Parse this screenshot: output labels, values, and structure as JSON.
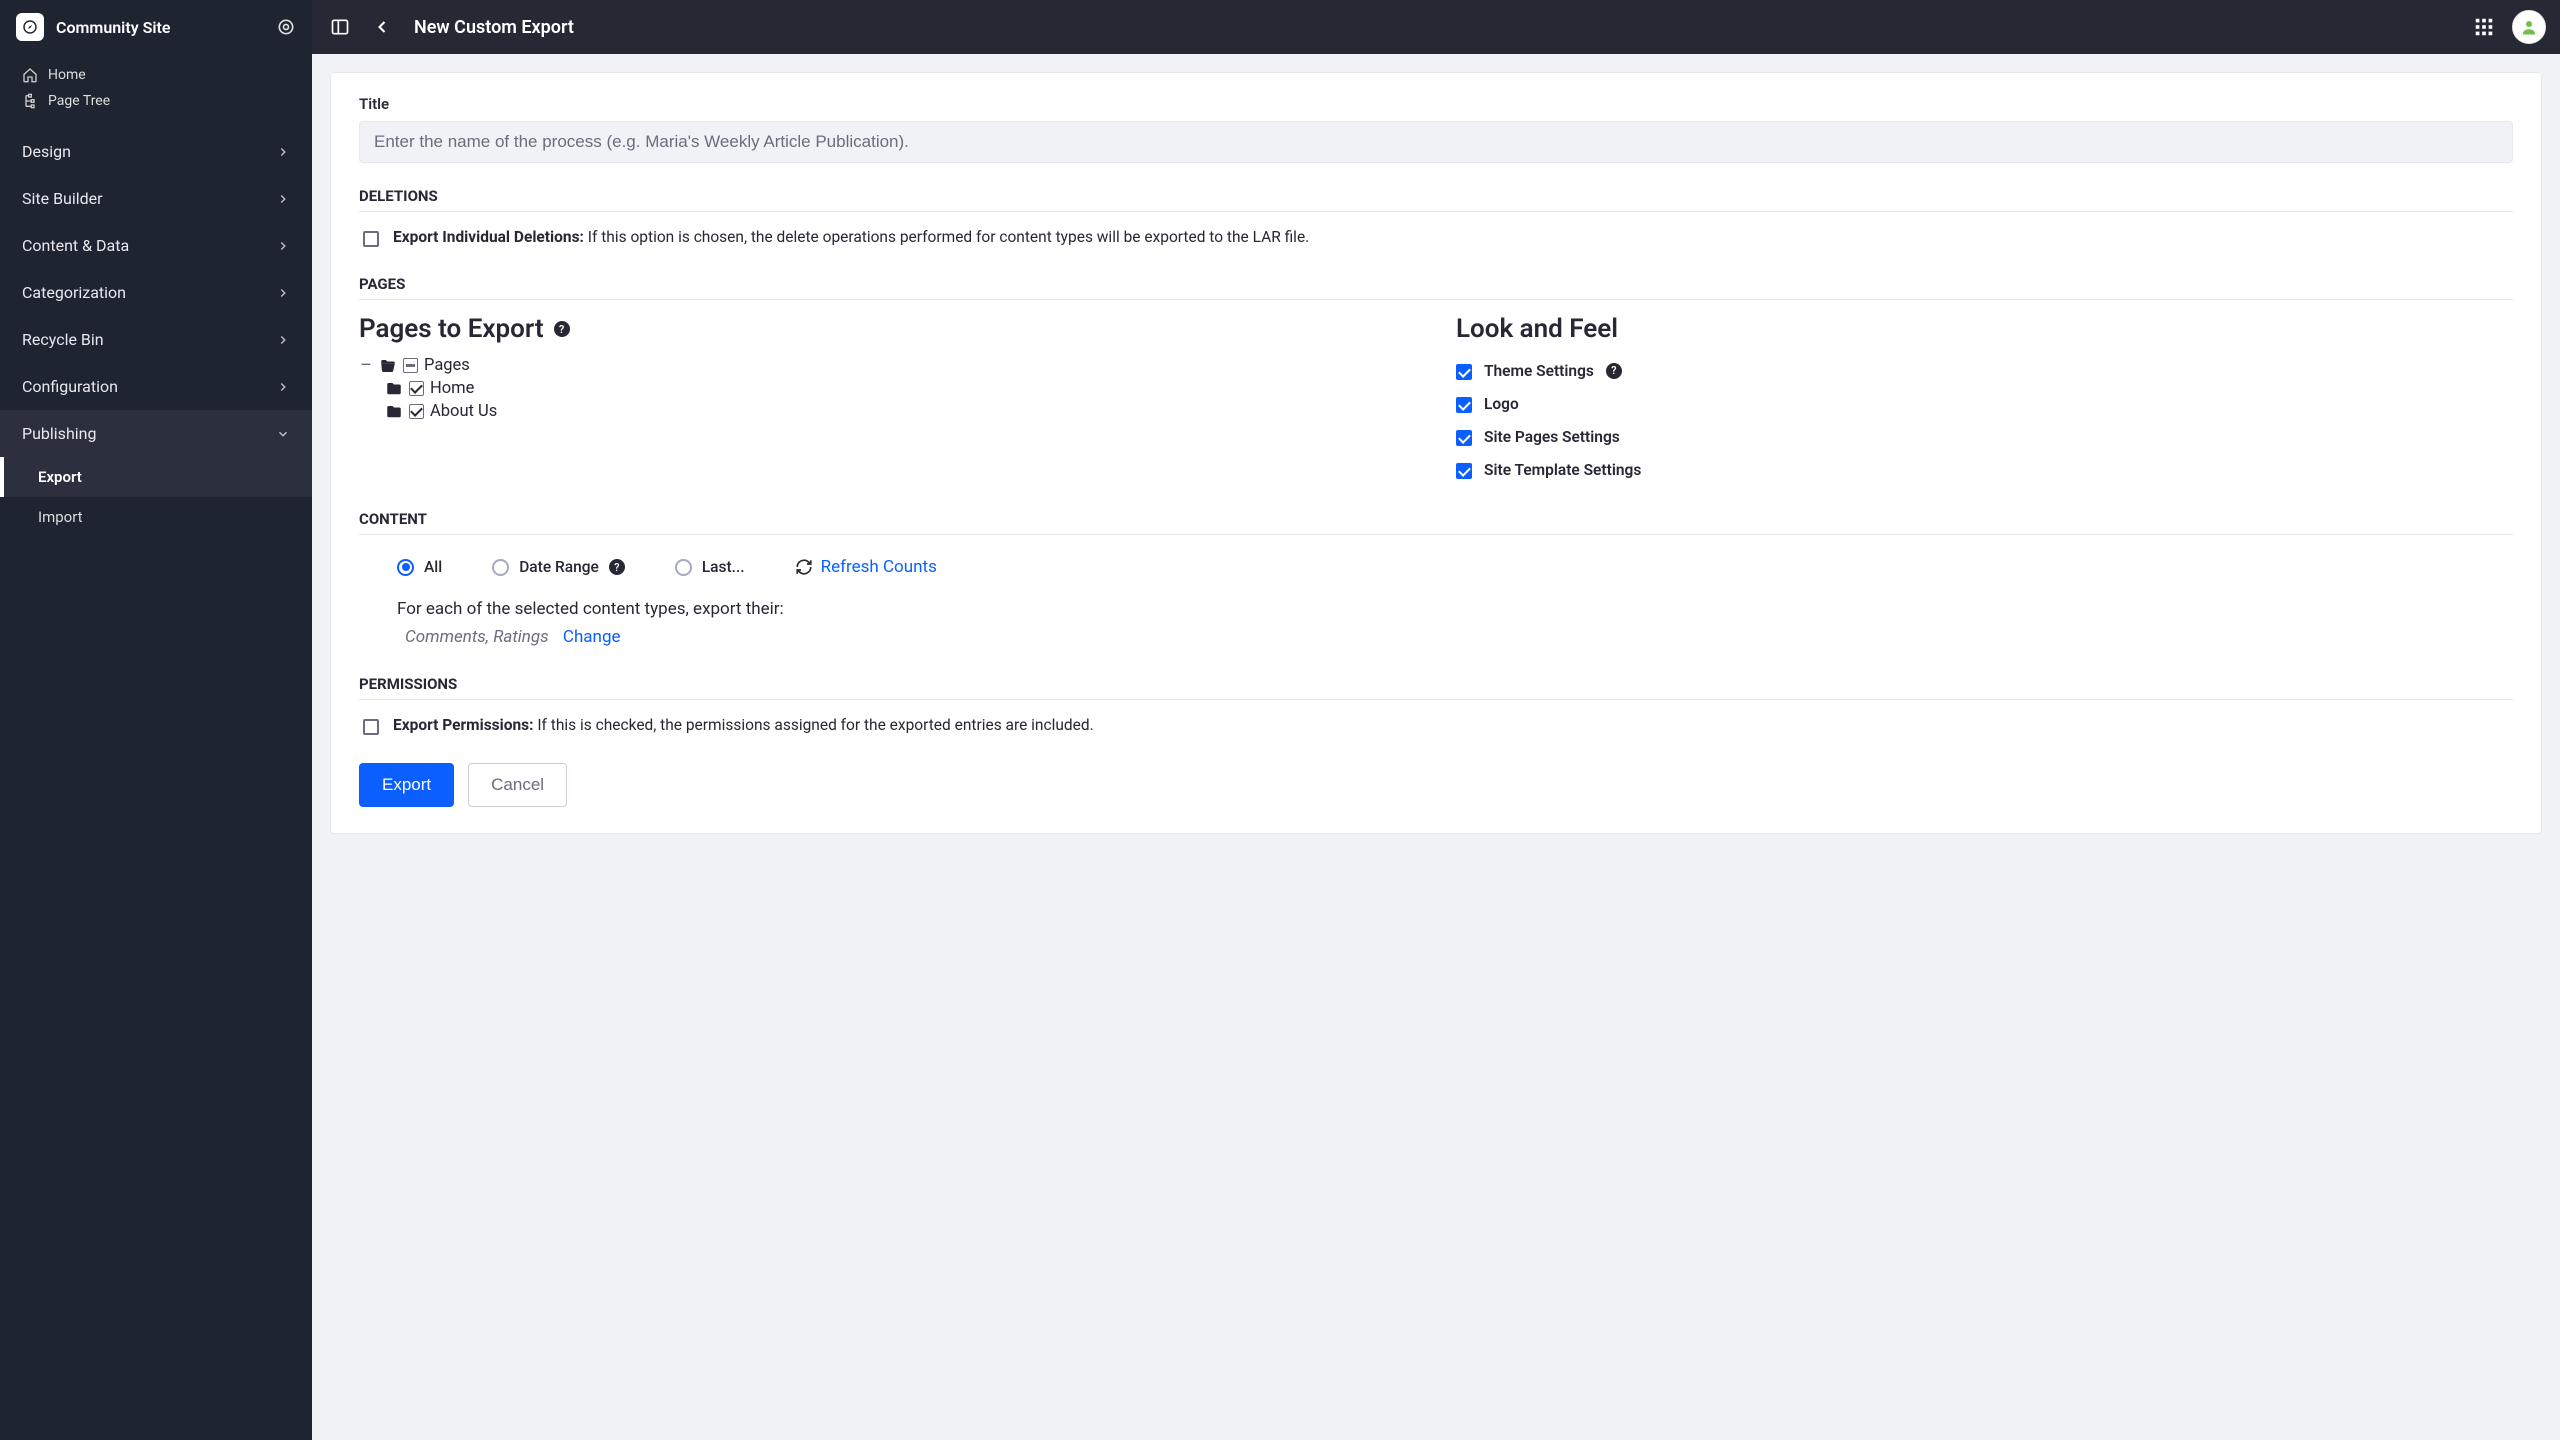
{
  "site": {
    "name": "Community Site"
  },
  "sidebar": {
    "quick": [
      {
        "label": "Home"
      },
      {
        "label": "Page Tree"
      }
    ],
    "sections": [
      {
        "label": "Design"
      },
      {
        "label": "Site Builder"
      },
      {
        "label": "Content & Data"
      },
      {
        "label": "Categorization"
      },
      {
        "label": "Recycle Bin"
      },
      {
        "label": "Configuration"
      },
      {
        "label": "Publishing"
      }
    ],
    "publishing": [
      {
        "label": "Export"
      },
      {
        "label": "Import"
      }
    ]
  },
  "topbar": {
    "title": "New Custom Export"
  },
  "form": {
    "title_label": "Title",
    "title_placeholder": "Enter the name of the process (e.g. Maria's Weekly Article Publication).",
    "deletions": {
      "heading": "DELETIONS",
      "label": "Export Individual Deletions:",
      "desc": "If this option is chosen, the delete operations performed for content types will be exported to the LAR file."
    },
    "pages": {
      "heading": "PAGES",
      "export_heading": "Pages to Export",
      "look_heading": "Look and Feel",
      "tree": {
        "root": "Pages",
        "children": [
          {
            "label": "Home"
          },
          {
            "label": "About Us"
          }
        ]
      },
      "look": [
        {
          "label": "Theme Settings",
          "help": true
        },
        {
          "label": "Logo",
          "help": false
        },
        {
          "label": "Site Pages Settings",
          "help": false
        },
        {
          "label": "Site Template Settings",
          "help": false
        }
      ]
    },
    "content": {
      "heading": "CONTENT",
      "radio": {
        "all": "All",
        "range": "Date Range",
        "last": "Last..."
      },
      "refresh": "Refresh Counts",
      "for_each": "For each of the selected content types, export their:",
      "selections": "Comments, Ratings",
      "change": "Change"
    },
    "permissions": {
      "heading": "PERMISSIONS",
      "label": "Export Permissions:",
      "desc": "If this is checked, the permissions assigned for the exported entries are included."
    },
    "buttons": {
      "export": "Export",
      "cancel": "Cancel"
    }
  }
}
